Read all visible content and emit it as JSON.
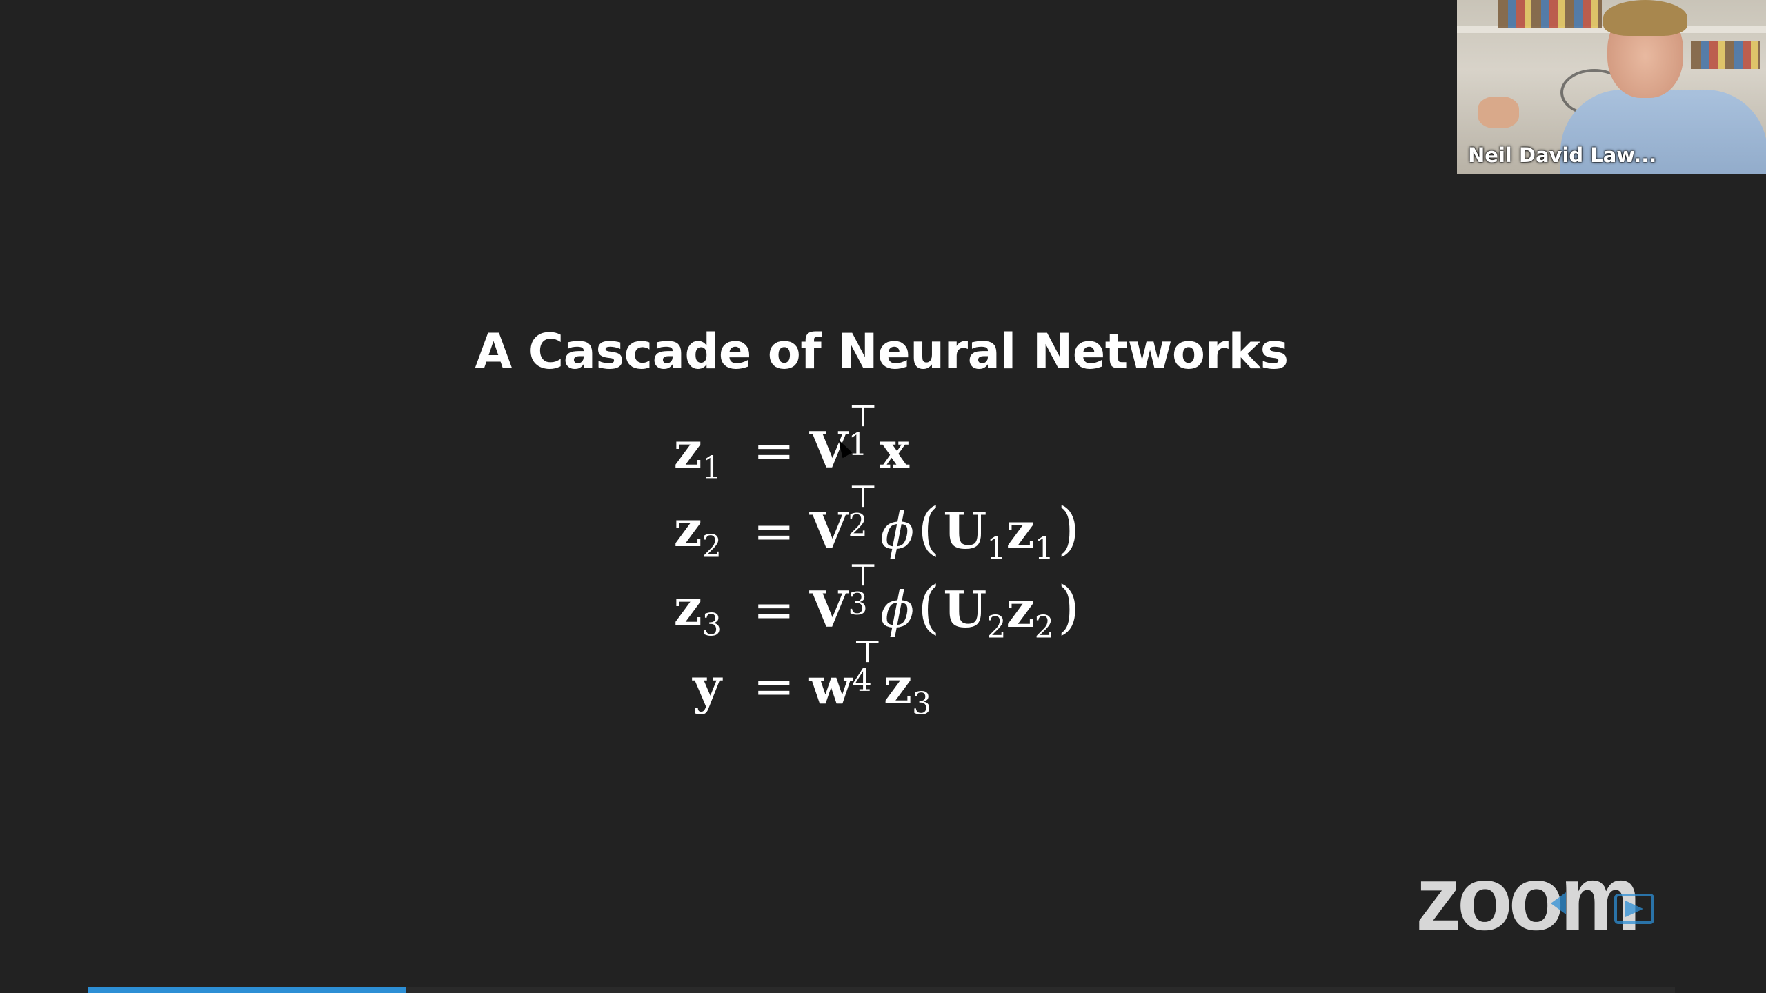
{
  "slide": {
    "title": "A Cascade of Neural Networks",
    "equations": [
      {
        "lhs": "z",
        "lhs_sub": "1",
        "eq": "=",
        "rhs_mat": "V",
        "rhs_mat_sub": "1",
        "transpose": "⊤",
        "rhs_tail": "x"
      },
      {
        "lhs": "z",
        "lhs_sub": "2",
        "eq": "=",
        "rhs_mat": "V",
        "rhs_mat_sub": "2",
        "transpose": "⊤",
        "func": "ϕ",
        "open": "(",
        "inner_mat": "U",
        "inner_mat_sub": "1",
        "inner_vec": "z",
        "inner_vec_sub": "1",
        "close": ")"
      },
      {
        "lhs": "z",
        "lhs_sub": "3",
        "eq": "=",
        "rhs_mat": "V",
        "rhs_mat_sub": "3",
        "transpose": "⊤",
        "func": "ϕ",
        "open": "(",
        "inner_mat": "U",
        "inner_mat_sub": "2",
        "inner_vec": "z",
        "inner_vec_sub": "2",
        "close": ")"
      },
      {
        "lhs": "y",
        "eq": "=",
        "rhs_mat": "w",
        "rhs_mat_sub": "4",
        "transpose": "⊤",
        "rhs_tail": "z",
        "rhs_tail_sub": "3"
      }
    ]
  },
  "video": {
    "speaker_name": "Neil David Law..."
  },
  "branding": {
    "logo_text": "zoom",
    "logo_color": "#ffffff"
  },
  "playback": {
    "progress_fraction": 0.2,
    "progress_color": "#2d8fd5"
  }
}
